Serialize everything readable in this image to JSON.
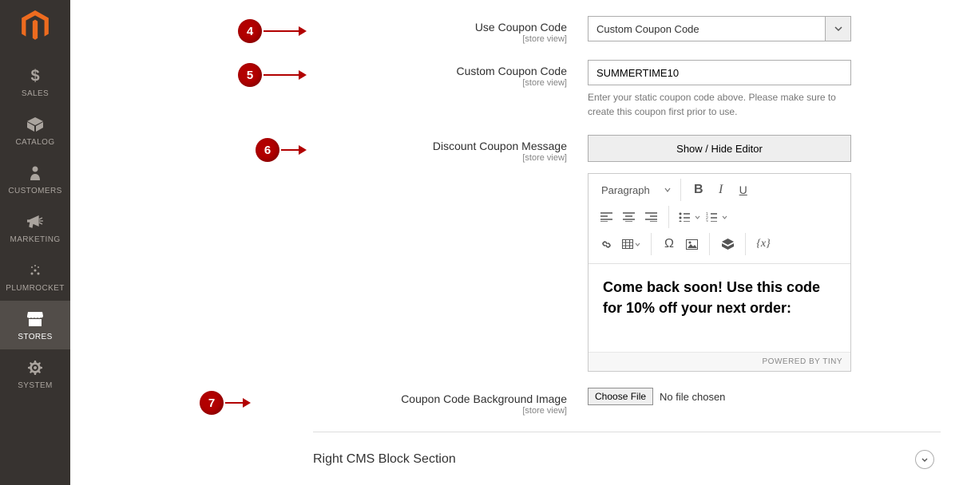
{
  "sidebar": {
    "items": [
      {
        "label": "SALES"
      },
      {
        "label": "CATALOG"
      },
      {
        "label": "CUSTOMERS"
      },
      {
        "label": "MARKETING"
      },
      {
        "label": "PLUMROCKET"
      },
      {
        "label": "STORES"
      },
      {
        "label": "SYSTEM"
      }
    ]
  },
  "fields": {
    "use_coupon": {
      "label": "Use Coupon Code",
      "scope": "[store view]",
      "value": "Custom Coupon Code",
      "badge": "4"
    },
    "custom_code": {
      "label": "Custom Coupon Code",
      "scope": "[store view]",
      "value": "SUMMERTIME10",
      "help": "Enter your static coupon code above. Please make sure to create this coupon first prior to use.",
      "badge": "5"
    },
    "message": {
      "label": "Discount Coupon Message",
      "scope": "[store view]",
      "toggle_btn": "Show / Hide Editor",
      "badge": "6",
      "paragraph_label": "Paragraph",
      "content": "Come back soon! Use this code for 10% off your next order:",
      "footer": "POWERED BY TINY"
    },
    "bg_image": {
      "label": "Coupon Code Background Image",
      "scope": "[store view]",
      "choose": "Choose File",
      "no_file": "No file chosen",
      "badge": "7"
    }
  },
  "section": {
    "title": "Right CMS Block Section"
  }
}
